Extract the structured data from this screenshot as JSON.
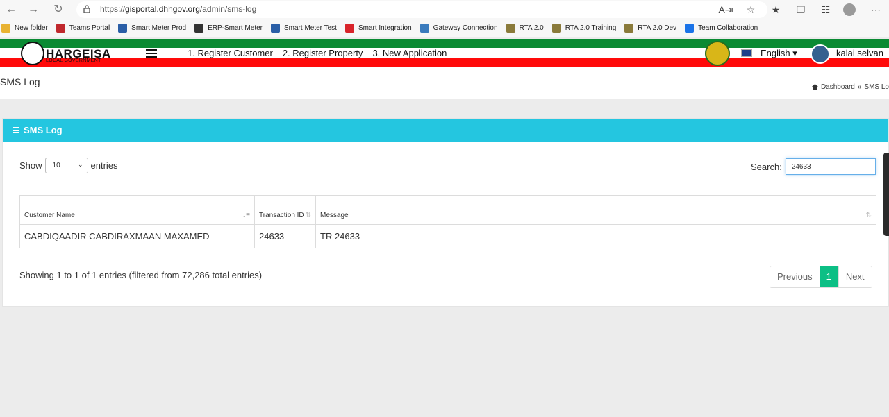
{
  "browser": {
    "url_prefix": "https://",
    "url_domain": "gisportal.dhhgov.org",
    "url_path": "/admin/sms-log",
    "bookmarks": [
      {
        "label": "New folder",
        "color": "#e8b232"
      },
      {
        "label": "Teams Portal",
        "color": "#c0282d"
      },
      {
        "label": "Smart Meter Prod",
        "color": "#2a5ea6"
      },
      {
        "label": "ERP-Smart Meter",
        "color": "#333333"
      },
      {
        "label": "Smart Meter Test",
        "color": "#2a5ea6"
      },
      {
        "label": "Smart Integration",
        "color": "#d8232a"
      },
      {
        "label": "Gateway Connection",
        "color": "#3a7bbd"
      },
      {
        "label": "RTA 2.0",
        "color": "#8a7a3a"
      },
      {
        "label": "RTA 2.0 Training",
        "color": "#8a7a3a"
      },
      {
        "label": "RTA 2.0 Dev",
        "color": "#8a7a3a"
      },
      {
        "label": "Team Collaboration",
        "color": "#1a73e8"
      }
    ]
  },
  "header": {
    "logo_title": "HARGEISA",
    "logo_subtitle": "LOCAL GOVERNMENT",
    "links": [
      "1. Register Customer",
      "2. Register Property",
      "3. New Application"
    ],
    "language": "English",
    "user_name": "kalai selvan"
  },
  "page": {
    "title": "SMS Log",
    "breadcrumb_home": "Dashboard",
    "breadcrumb_sep": "»",
    "breadcrumb_current": "SMS Lo"
  },
  "card": {
    "title": "SMS Log",
    "show_label": "Show",
    "entries_label": "entries",
    "page_size": "10",
    "search_label": "Search:",
    "search_value": "24633",
    "columns": [
      "Customer Name",
      "Transaction ID",
      "Message"
    ],
    "rows": [
      {
        "name": "CABDIQAADIR CABDIRAXMAAN MAXAMED",
        "tid": "24633",
        "message": "TR 24633"
      }
    ],
    "info": "Showing 1 to 1 of 1 entries (filtered from 72,286 total entries)",
    "pager": {
      "previous": "Previous",
      "page": "1",
      "next": "Next"
    }
  },
  "colors": {
    "accent": "#24c6e0",
    "green": "#0a8a33",
    "red": "#ff0a0a",
    "active_page": "#0cbf85"
  }
}
